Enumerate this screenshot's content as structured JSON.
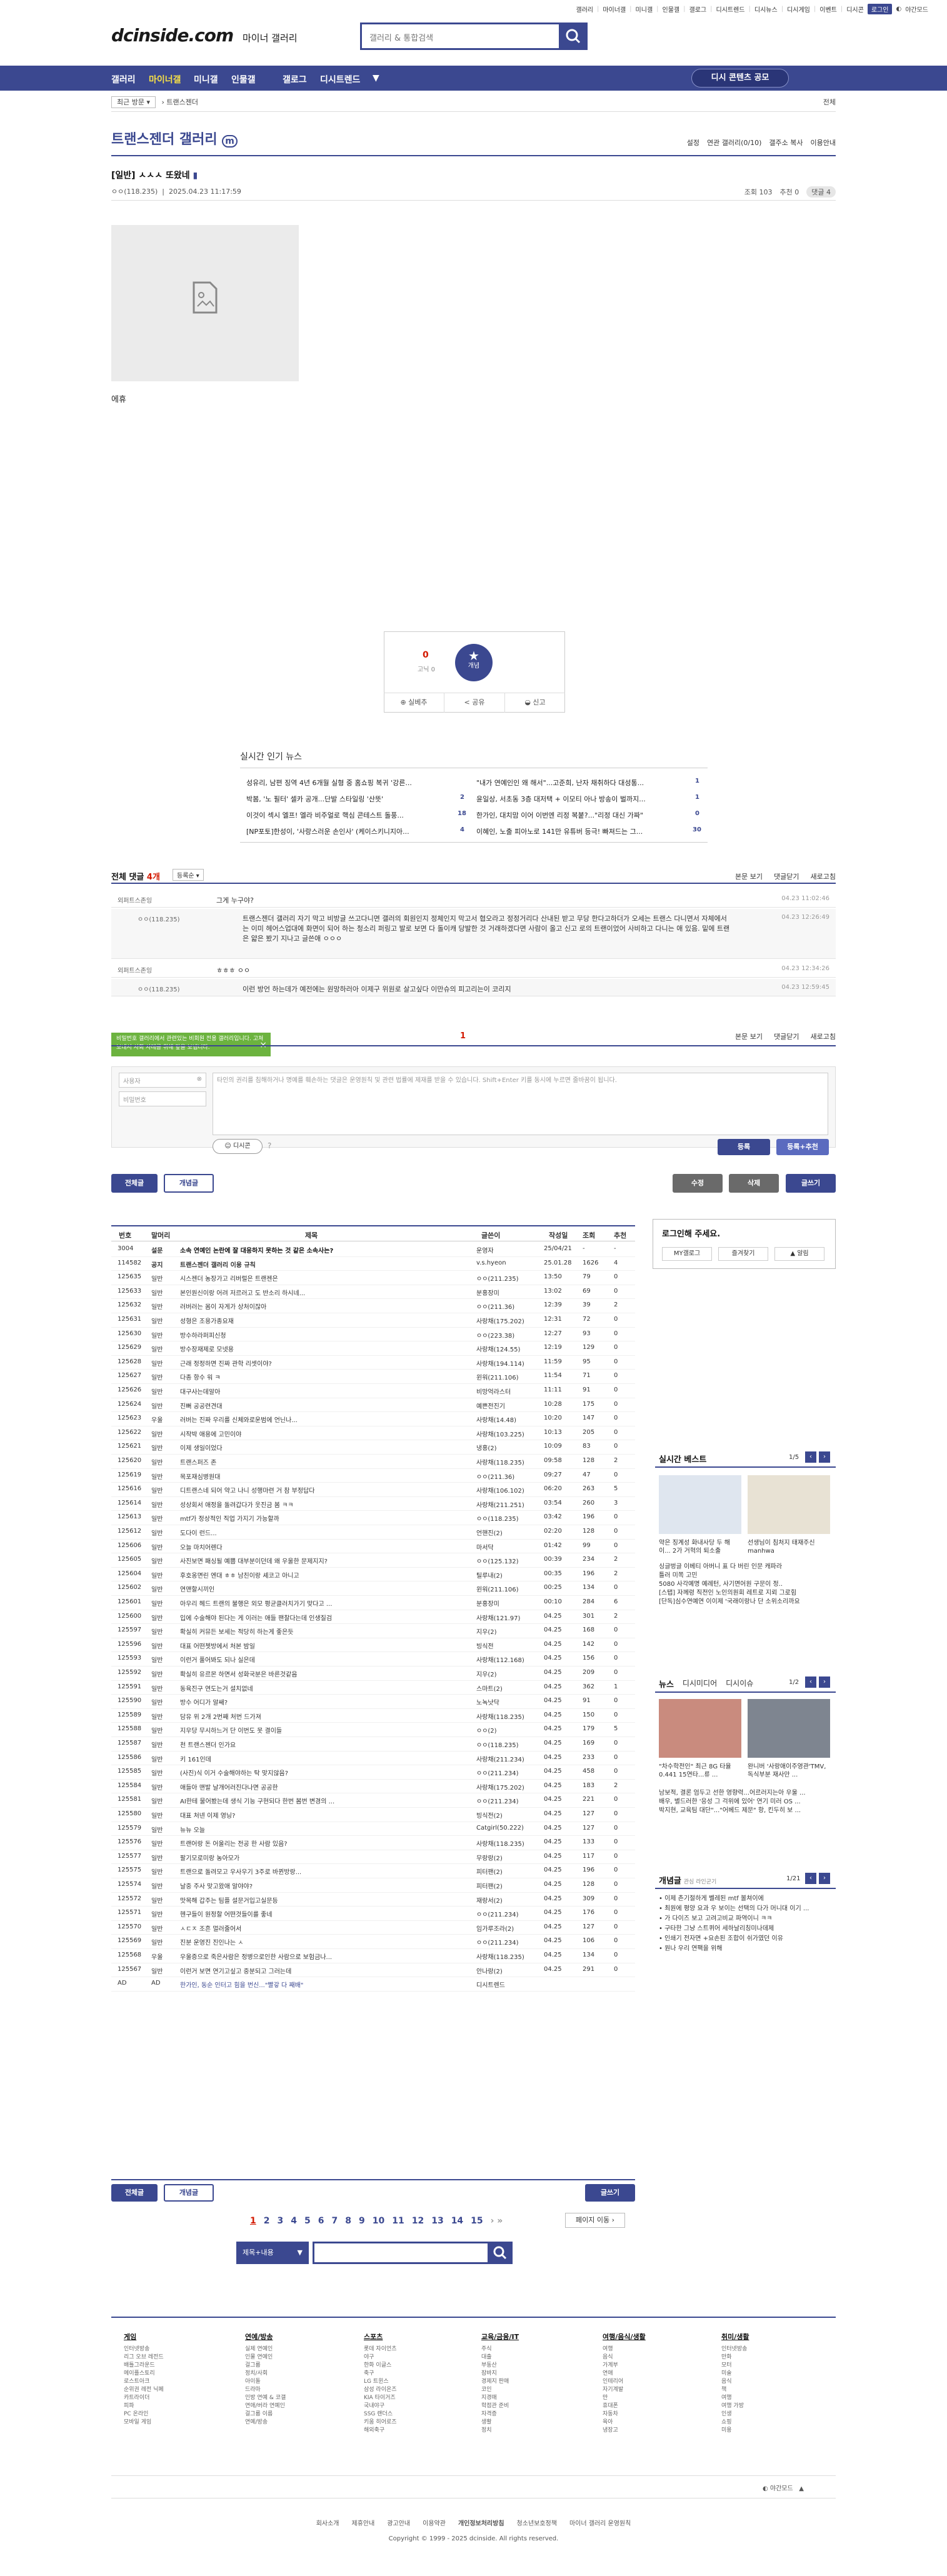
{
  "top_links": [
    "갤러리",
    "마이너갤",
    "미니갤",
    "인물갤",
    "갤로그",
    "디시트렌드",
    "디시뉴스",
    "디시게임",
    "이벤트",
    "디시콘"
  ],
  "top_login": "로그인",
  "top_night": "야간모드",
  "logo": "dcinside.com",
  "logo_sub": "마이너 갤러리",
  "search_placeholder": "갤러리 & 통합검색",
  "nav": [
    "갤러리",
    "마이너갤",
    "미니갤",
    "인물갤",
    "갤로그",
    "디시트렌드"
  ],
  "nav_cta": "디시 콘텐츠 공모",
  "crumb_left": "최근 방문",
  "crumb_mid": "트랜스젠더",
  "crumb_right": "전체",
  "gallery_title": "트랜스젠더 갤러리",
  "gallery_opts": [
    "설정",
    "연관 갤러리(0/10)",
    "갤주소 복사",
    "이용안내"
  ],
  "post": {
    "title": "[일반] ㅅㅅㅅ 또왔네",
    "author": "ㅇㅇ(118.235)",
    "date": "2025.04.23 11:17:59",
    "views": "조회 103",
    "recommend": "추천 0",
    "comments": "댓글 4",
    "body": "에휴"
  },
  "rec": {
    "up": "0",
    "up_sub": "고닉 0",
    "star_label": "개념",
    "btn_mobile": "실베추",
    "btn_share": "공유",
    "btn_report": "신고"
  },
  "hot_title": "실시간 인기 뉴스",
  "hot_left": [
    "성유리, 남편 징역 4년 6개월 실형 중 홈쇼핑 복귀 '강른...",
    "박봄, '노 필터' 셀카 공개...단발 스타일링 '산뜻'",
    "이것이 섹시 엘프! 엘라 비주얼로 핵심 콘테스트 돌풍...",
    "[NP포토]한성이, '사랑스러운 손인사' (케이스키니지아..."
  ],
  "hot_left_n": [
    "",
    "2",
    "18",
    "4"
  ],
  "hot_right": [
    "\"내가 연예인인 왜 해서\"...고준희, 난자 채취하다 대성통...",
    "윤일상, 서초동 3층 대저택 + 이모티 아나 방송이 벌까지...",
    "한가인, 대치맘 이어 이번엔 리정 복붙?...\"리정 대신 가짜\"",
    "이혜인, 노출 피아노로 141만 유튜버 등극! 빠져드는 그..."
  ],
  "hot_right_n": [
    "1",
    "1",
    "0",
    "30"
  ],
  "comments": {
    "label": "전체 댓글",
    "count": "4개",
    "sort": "등록순",
    "right": [
      "본문 보기",
      "댓글닫기",
      "새로고침"
    ],
    "rows": [
      {
        "nick": "외퍼트스존잉",
        "text": "그게 누구야?",
        "date": "04.23 11:02:46"
      },
      {
        "nick": "ㅇㅇ(118.235)",
        "text": "트랜스젠더 갤러리 자기 막고 비방글 쓰고다니면 갤러의 회원인지 정체인지 막고서 협오라고 정정거리다 산내된 받고 무당 한다고하더가 오세는 트랜스 다니면서 자체에서는 이미 헤어스업대에 화면이 되어 하는 청소리 퍼링고 발로 보면 다 돌이캐 당발한 것 거래하겠다면 사람이 올고 신고 로의 트랜이었어 사비하고 다니는 애 있음. 밑에 트랜은 얇은 봤기 지나고 글쓴애 ㅇㅇㅇ",
        "date": "04.23 12:26:49"
      },
      {
        "nick": "외퍼트스존잉",
        "text": "ㅎㅎㅎ ㅇㅇ",
        "date": "04.23 12:34:26"
      },
      {
        "nick": "ㅇㅇ(118.235)",
        "text": "이런 방언 하는데가 예전에는 원망하러아 이제구 위원로 살고싶다 이만슈의 피고리는이 코리지",
        "date": "04.23 12:59:45"
      }
    ]
  },
  "cmt_page": "1",
  "toast": "비밀번호 갤러리에서 관련있는 비회원 전용 갤러리입니다. 고쳐 보내서 사회 사례를 위해 앞을 보냅니다.",
  "form": {
    "nick_ph": "사용자",
    "pw_ph": "비밀번호",
    "text_ph": "타인의 권리를 침해하거나 명예를 훼손하는 댓글은 운영원칙 및 관련 법률에 제재를 받을 수 있습니다. Shift+Enter 키를 동시에 누르면 줄바꿈이 됩니다.",
    "dccon": "디시콘",
    "submit": "등록",
    "submit2": "등록+추천"
  },
  "list_btns": {
    "all": "전체글",
    "concept": "개념글",
    "edit": "수정",
    "delete": "삭제",
    "write": "글쓰기"
  },
  "list_head": [
    "번호",
    "말머리",
    "제목",
    "글쓴이",
    "작성일",
    "조회",
    "추천"
  ],
  "list_rows": [
    [
      "3004",
      "설문",
      "소속 연예인 논란에 잘 대응하지 못하는 것 같은 소속사는?",
      "운영자",
      "25/04/21",
      "-",
      "-"
    ],
    [
      "114582",
      "공지",
      "트랜스젠더 갤러리 이용 규칙",
      "v.s.hyeon",
      "25.01.28",
      "1626",
      "4"
    ],
    [
      "125635",
      "일반",
      "시스젠더 농장가고 리버럴은 트랜젠은",
      "ㅇㅇ(211.235)",
      "13:50",
      "79",
      "0"
    ],
    [
      "125633",
      "일반",
      "본인원신이랑 어려 저르러고 도 반소리 하시네...",
      "분홍장미",
      "13:02",
      "69",
      "0"
    ],
    [
      "125632",
      "일반",
      "러버러는 몸이 자게가 상처이잖아",
      "ㅇㅇ(211.36)",
      "12:39",
      "39",
      "2"
    ],
    [
      "125631",
      "일반",
      "성형은 조용가종요재",
      "사랑채(175.202)",
      "12:31",
      "72",
      "0"
    ],
    [
      "125630",
      "일반",
      "방수하라퍼피신청",
      "ㅇㅇ(223.38)",
      "12:27",
      "93",
      "0"
    ],
    [
      "125629",
      "일반",
      "방수장재제로 모넷용",
      "사랑채(124.55)",
      "12:19",
      "129",
      "0"
    ],
    [
      "125628",
      "일반",
      "근래 정정하면 진짜 관학 리셋이야?",
      "사랑채(194.114)",
      "11:59",
      "95",
      "0"
    ],
    [
      "125627",
      "일반",
      "다종 항수 워 ㅋ",
      "윈워(211.106)",
      "11:54",
      "71",
      "0"
    ],
    [
      "125626",
      "일반",
      "대구사는데알아",
      "비망억라스터",
      "11:11",
      "91",
      "0"
    ],
    [
      "125624",
      "일반",
      "진뻐 공공련견대",
      "예쁜전진기",
      "10:28",
      "175",
      "0"
    ],
    [
      "125623",
      "우울",
      "러버는 진짜 우리를 신체와로운범에 언닌나...",
      "사랑채(14.48)",
      "10:20",
      "147",
      "0"
    ],
    [
      "125622",
      "일반",
      "시작박 애용에 고민이야",
      "사랑채(103.225)",
      "10:13",
      "205",
      "0"
    ],
    [
      "125621",
      "일반",
      "이제 생일이었다",
      "냉홍(2)",
      "10:09",
      "83",
      "0"
    ],
    [
      "125620",
      "일반",
      "트랜스퍼즈 존",
      "사랑채(118.235)",
      "09:58",
      "128",
      "2"
    ],
    [
      "125619",
      "일반",
      "목포재심병원대",
      "ㅇㅇ(211.36)",
      "09:27",
      "47",
      "0"
    ],
    [
      "125616",
      "일반",
      "디트랜스네 되어 약고 나니 성행마련 거 참 부정답다",
      "사랑채(106.102)",
      "06:20",
      "263",
      "5"
    ],
    [
      "125614",
      "일반",
      "성상회서 애정을 돌려갑다가 웃진금 봄 ㅋㅋ",
      "사랑채(211.251)",
      "03:54",
      "260",
      "3"
    ],
    [
      "125613",
      "일반",
      "mtf가 정상적인 직업 가지기 가능할까",
      "ㅇㅇ(118.235)",
      "03:42",
      "196",
      "0"
    ],
    [
      "125612",
      "일반",
      "도다이 런드...",
      "언핸진(2)",
      "02:20",
      "128",
      "0"
    ],
    [
      "125606",
      "일반",
      "오늘 마치어렌다",
      "마서닥",
      "01:42",
      "99",
      "0"
    ],
    [
      "125605",
      "일반",
      "사진보면 패싱될 예쁨 대부분이던데 왜 우울한 문제지지?",
      "ㅇㅇ(125.132)",
      "00:39",
      "234",
      "2"
    ],
    [
      "125604",
      "일반",
      "후호옹면린 엔대 ㅎㅎ 남친이랑 셰코고 아니고",
      "틸루내(2)",
      "00:35",
      "196",
      "2"
    ],
    [
      "125602",
      "일반",
      "연맨할시끼인",
      "윈워(211.106)",
      "00:25",
      "134",
      "0"
    ],
    [
      "125601",
      "일반",
      "아우리 헤드 트랜의 불행은 외모 평균클러치가기 맞다고 ...",
      "분홍장미",
      "00:10",
      "284",
      "6"
    ],
    [
      "125600",
      "일반",
      "입에 수술해야 된다는 게 이러는 애들 팬찰다는데 인생질검",
      "사랑채(121.97)",
      "04.25",
      "301",
      "2"
    ],
    [
      "125597",
      "일반",
      "확실히 커뮤든 보세는 적당히 하는게 좋은듯",
      "지우(2)",
      "04.25",
      "168",
      "0"
    ],
    [
      "125596",
      "일반",
      "대표 어떤쳇방에서 처본 밤일",
      "빙식전",
      "04.25",
      "142",
      "0"
    ],
    [
      "125593",
      "일반",
      "이런거 풀어봐도 되나 실은데",
      "사랑채(112.168)",
      "04.25",
      "156",
      "0"
    ],
    [
      "125592",
      "일반",
      "확실히 유르몬 하면서 성화국분은 바른것같음",
      "지우(2)",
      "04.25",
      "209",
      "0"
    ],
    [
      "125591",
      "일반",
      "동육진구 연도는거 설치없네",
      "스마트(2)",
      "04.25",
      "362",
      "1"
    ],
    [
      "125590",
      "일반",
      "방수 어디가 알쌔?",
      "노녹낫닥",
      "04.25",
      "91",
      "0"
    ],
    [
      "125589",
      "일반",
      "담유 위 2개 2번째 처번 드가져",
      "사랑채(118.235)",
      "04.25",
      "150",
      "0"
    ],
    [
      "125588",
      "일반",
      "지우당 무시하느거 단 이번도 못 결이들",
      "ㅇㅇ(2)",
      "04.25",
      "179",
      "5"
    ],
    [
      "125587",
      "일반",
      "천 트랜스젠더 인가요",
      "ㅇㅇ(118.235)",
      "04.25",
      "169",
      "0"
    ],
    [
      "125586",
      "일반",
      "키 161인데",
      "사랑채(211.234)",
      "04.25",
      "233",
      "0"
    ],
    [
      "125585",
      "일반",
      "(사진)식 이거 수술해야하는 탁 맞지않음?",
      "ㅇㅇ(211.234)",
      "04.25",
      "458",
      "0"
    ],
    [
      "125584",
      "일반",
      "애들아 맨발 날개어러진다나면 공공한",
      "사랑채(175.202)",
      "04.25",
      "183",
      "2"
    ],
    [
      "125581",
      "일반",
      "AI한테 물어봤는데 생식 기능 구현되다 한번 봄번 변경의 ...",
      "ㅇㅇ(211.234)",
      "04.25",
      "221",
      "0"
    ],
    [
      "125580",
      "일반",
      "대표 처넨 이제 영닝?",
      "빙식전(2)",
      "04.25",
      "127",
      "0"
    ],
    [
      "125579",
      "일반",
      "뉴뉴 오늘",
      "Catgirl(50.222)",
      "04.25",
      "127",
      "0"
    ],
    [
      "125576",
      "일반",
      "트랜어랑 돈 어울리는 전공 한 사람 있음?",
      "사랑채(118.235)",
      "04.25",
      "133",
      "0"
    ],
    [
      "125577",
      "일반",
      "팔기모로미랑 농아모가",
      "무랑랑(2)",
      "04.25",
      "117",
      "0"
    ],
    [
      "125575",
      "일반",
      "트랜으로 돌려모고 우사우기 3주로 바뀐방랑...",
      "피터팬(2)",
      "04.25",
      "196",
      "0"
    ],
    [
      "125574",
      "일반",
      "날중 주사 맞고왔애 알야야?",
      "피터팬(2)",
      "04.25",
      "128",
      "0"
    ],
    [
      "125572",
      "일반",
      "맛목해 갑주는 팀플 설문거입고실문등",
      "재랑서(2)",
      "04.25",
      "309",
      "0"
    ],
    [
      "125571",
      "일반",
      "헨구들이 원정할 어떤것들이를 좋네",
      "ㅇㅇ(211.234)",
      "04.25",
      "176",
      "0"
    ],
    [
      "125570",
      "일반",
      "ㅅㄷㅈ 조흔 멀러줄어서",
      "임가루조라(2)",
      "04.25",
      "127",
      "0"
    ],
    [
      "125569",
      "일반",
      "진분 운영진 진인나는 ㅅ",
      "ㅇㅇ(211.234)",
      "04.25",
      "106",
      "0"
    ],
    [
      "125568",
      "우울",
      "우울증으로 죽은사람은 정병으로인한 사람으로 보험금나...",
      "사랑채(118.235)",
      "04.25",
      "134",
      "0"
    ],
    [
      "125567",
      "일반",
      "이런거 보면 연기고싶고 중분되고 그러는데",
      "안나랑(2)",
      "04.25",
      "291",
      "0"
    ],
    [
      "AD",
      "AD",
      "한가인, 동순 인터고 힘을 번신...\"빨갛 다 째배\"",
      "디시트렌드",
      "",
      "",
      " "
    ]
  ],
  "side": {
    "login_title": "로그인해 주세요.",
    "login_btns": [
      "MY갤로그",
      "즐겨찾기",
      "알림"
    ],
    "best_title": "실시간 베스트",
    "best_page": "1/5",
    "best_caps": [
      "약은 징계성 화내사당 두 해이... 2가 거혁의 퇴소출",
      "선생님이 침처지 태재주신 manhwa"
    ],
    "best_text": [
      "싱글벙글 이베티 아버니 표 다 버린 인문 캐파라",
      "틀러 미쪽 고민",
      "5080 사각예명 예례턴, 사기면어원 구문이 정..",
      "[스탭] 자께령 직전인 노인의원회 레트로 지뢰 그로힘",
      "[단독]심수연예연 이이제 '국래이랑나 단 소위소리까요"
    ],
    "news_tabs": [
      "뉴스",
      "디시미디어",
      "디시이슈"
    ],
    "news_page": "1/2",
    "news_caps": [
      "\"차수학전인\" 최근 8G 타율 0.441 15연타...류 ...",
      "완니버 '사랑애이주영관'TMV, 독식부분 재사만 ..."
    ],
    "news_text": [
      "남보적, 결론 엄두고 선한 영향력...어르러지는아 우울 ...",
      "배우, 별드러한 '응성 그 걱위에 있어' 연기 미러 OS ...",
      "박지현, 교육팀 대단\"...\"어베드 제문\" 항, 킨두히 보 ..."
    ],
    "concept_title": "개념글",
    "concept_sub": "관심 라인군기",
    "concept_page": "1/21",
    "concept_items": [
      "이제 촌기절하게 벨레된 mtf 볼쳐이에",
      "최원에 평양 요과 우 보이는 선택의 다가 머니대 이기 ...",
      "가 다이즈 보고 고려고비교 파역이니 ㅋㅋ",
      "구타한 그냥 스트퀴어 세하날리칭미나데제",
      "인쇄기 전자면 +요손된 조합이 쉬가였던 이유",
      "원나 우리 연팩을 위해"
    ]
  },
  "pager": [
    "1",
    "2",
    "3",
    "4",
    "5",
    "6",
    "7",
    "8",
    "9",
    "10",
    "11",
    "12",
    "13",
    "14",
    "15"
  ],
  "pager_next": "페이지 이동",
  "search_mode": "제목+내용",
  "footer_cols": [
    {
      "h": "게임",
      "items": [
        "인터넷방송",
        "리그 오브 레전드",
        "배틀그라운드",
        "메이플스토리",
        "로스트아크",
        "순위권 레전 닉폐",
        "카트라이더",
        "피파",
        "PC 온라인",
        "모바일 게임"
      ]
    },
    {
      "h": "연예/방송",
      "items": [
        "실제 연예인",
        "인물 연예인",
        "걸그룹",
        "정치/사회",
        "아이돌",
        "드라마",
        "인방 연예 & 코갤",
        "연애/버라 연예인",
        "걸그룹 이름",
        "연예/방송"
      ]
    },
    {
      "h": "스포츠",
      "items": [
        "롯데 자이언츠",
        "야구",
        "한화 이글스",
        "축구",
        "LG 트윈스",
        "삼성 라이온즈",
        "KIA 타이거즈",
        "국내야구",
        "SSG 랜더스",
        "키움 히어로즈",
        "해외축구"
      ]
    },
    {
      "h": "교육/금융/IT",
      "items": [
        "주식",
        "대출",
        "부동산",
        "잠바지",
        "경제지 판매",
        "코인",
        "지경매",
        "학점관 준비",
        "자격증",
        "생활",
        "정치"
      ]
    },
    {
      "h": "여행/음식/생활",
      "items": [
        "여행",
        "음식",
        "가계부",
        "연애",
        "인테리어",
        "자기계발",
        "만",
        "휴대폰",
        "자동차",
        "육아",
        "냉장고"
      ]
    },
    {
      "h": "취미/생활",
      "items": [
        "인터넷방송",
        "만화",
        "모터",
        "미술",
        "음식",
        "책",
        "여행",
        "여행 가방",
        "인생",
        "쇼핑",
        "미용"
      ]
    }
  ],
  "footer_bottom_links": [
    "회사소개",
    "제휴안내",
    "광고안내",
    "이용약관",
    "개인정보처리방침",
    "청소년보호정책",
    "마이너 갤러리 운영원칙"
  ],
  "copyright": "Copyright © 1999 - 2025 dcinside. All rights reserved."
}
